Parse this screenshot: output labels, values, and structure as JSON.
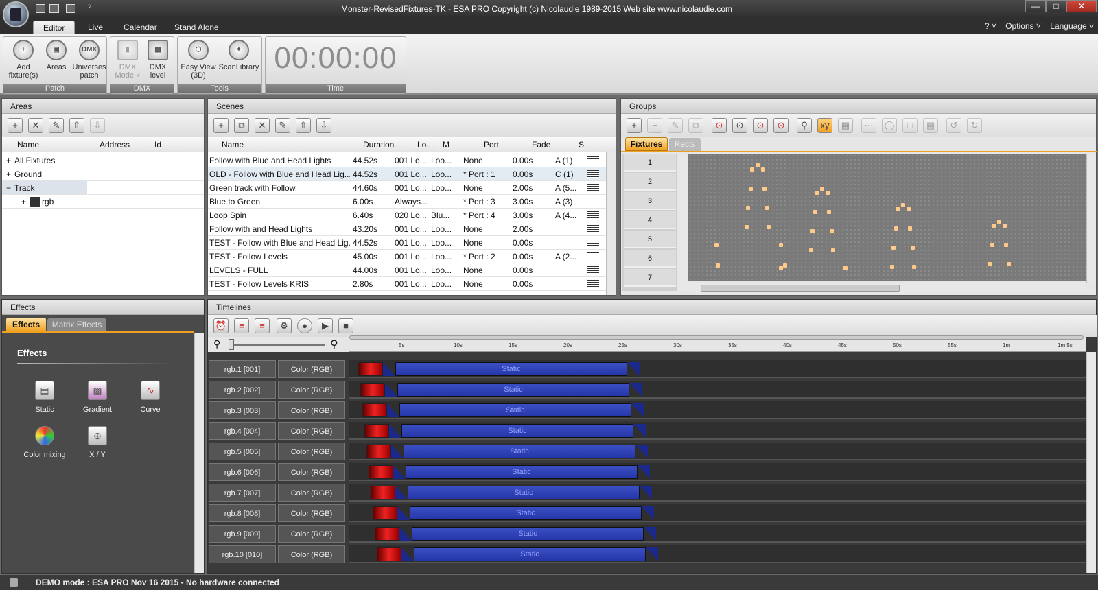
{
  "window": {
    "title": "Monster-RevisedFixtures-TK - ESA PRO    Copyright (c) Nicolaudie 1989-2015    Web site www.nicolaudie.com",
    "minimize": "—",
    "maximize": "□",
    "close": "✕"
  },
  "tabs": [
    "Editor",
    "Live",
    "Calendar",
    "Stand Alone"
  ],
  "right_menu": {
    "help": "? ˅",
    "options": "Options ˅",
    "language": "Language ˅"
  },
  "ribbon": {
    "patch": {
      "label": "Patch",
      "buttons": [
        "Add fixture(s)",
        "Areas",
        "Universes patch"
      ]
    },
    "dmx": {
      "label": "DMX",
      "buttons": [
        "DMX Mode ˅",
        "DMX level"
      ]
    },
    "tools": {
      "label": "Tools",
      "buttons": [
        "Easy View (3D)",
        "ScanLibrary"
      ]
    },
    "time": {
      "label": "Time",
      "value": "00:00:00"
    }
  },
  "areas": {
    "title": "Areas",
    "columns": [
      "Name",
      "Address",
      "Id"
    ],
    "tree": [
      {
        "label": "All Fixtures",
        "expander": "+"
      },
      {
        "label": "Ground",
        "expander": "+"
      },
      {
        "label": "Track",
        "expander": "−"
      },
      {
        "label": "rgb",
        "expander": "+"
      }
    ]
  },
  "scenes": {
    "title": "Scenes",
    "columns": [
      "Name",
      "Duration",
      "Lo...",
      "M",
      "Port",
      "Fade",
      "S"
    ],
    "rows": [
      [
        "Follow with Blue and Head Lights",
        "44.52s",
        "001 Lo...",
        "Loo...",
        "None",
        "0.00s",
        "A (1)"
      ],
      [
        "OLD - Follow with Blue and Head Lig...",
        "44.52s",
        "001 Lo...",
        "Loo...",
        "* Port : 1",
        "0.00s",
        "C (1)"
      ],
      [
        "Green track with Follow",
        "44.60s",
        "001 Lo...",
        "Loo...",
        "None",
        "2.00s",
        "A (5..."
      ],
      [
        "Blue to Green",
        "6.00s",
        "Always...",
        "",
        "* Port : 3",
        "3.00s",
        "A (3)"
      ],
      [
        "Loop Spin",
        "6.40s",
        "020 Lo...",
        "Blu...",
        "* Port : 4",
        "3.00s",
        "A (4..."
      ],
      [
        "Follow with and Head Lights",
        "43.20s",
        "001 Lo...",
        "Loo...",
        "None",
        "2.00s",
        ""
      ],
      [
        "TEST - Follow with Blue and Head Lig...",
        "44.52s",
        "001 Lo...",
        "Loo...",
        "None",
        "0.00s",
        ""
      ],
      [
        "TEST - Follow Levels",
        "45.00s",
        "001 Lo...",
        "Loo...",
        "* Port : 2",
        "0.00s",
        "A (2..."
      ],
      [
        "LEVELS - FULL",
        "44.00s",
        "001 Lo...",
        "Loo...",
        "None",
        "0.00s",
        ""
      ],
      [
        "TEST - Follow Levels KRIS",
        "2.80s",
        "001 Lo...",
        "Loo...",
        "None",
        "0.00s",
        ""
      ]
    ]
  },
  "groups": {
    "title": "Groups",
    "tabs": [
      "Fixtures",
      "Rects"
    ],
    "row_numbers": [
      "1",
      "2",
      "3",
      "4",
      "5",
      "6",
      "7"
    ]
  },
  "effects": {
    "title": "Effects",
    "tabs": [
      "Effects",
      "Matrix Effects"
    ],
    "heading": "Effects",
    "items": [
      "Static",
      "Gradient",
      "Curve",
      "Color mixing",
      "X / Y"
    ]
  },
  "timelines": {
    "title": "Timelines",
    "ticks": [
      "5s",
      "10s",
      "15s",
      "20s",
      "25s",
      "30s",
      "35s",
      "40s",
      "45s",
      "50s",
      "55s",
      "1m",
      "1m 5s"
    ],
    "rows": [
      {
        "name": "rgb.1 [001]",
        "type": "Color (RGB)",
        "clip": "Static"
      },
      {
        "name": "rgb.2 [002]",
        "type": "Color (RGB)",
        "clip": "Static"
      },
      {
        "name": "rgb.3 [003]",
        "type": "Color (RGB)",
        "clip": "Static"
      },
      {
        "name": "rgb.4 [004]",
        "type": "Color (RGB)",
        "clip": "Static"
      },
      {
        "name": "rgb.5 [005]",
        "type": "Color (RGB)",
        "clip": "Static"
      },
      {
        "name": "rgb.6 [006]",
        "type": "Color (RGB)",
        "clip": "Static"
      },
      {
        "name": "rgb.7 [007]",
        "type": "Color (RGB)",
        "clip": "Static"
      },
      {
        "name": "rgb.8 [008]",
        "type": "Color (RGB)",
        "clip": "Static"
      },
      {
        "name": "rgb.9 [009]",
        "type": "Color (RGB)",
        "clip": "Static"
      },
      {
        "name": "rgb.10 [010]",
        "type": "Color (RGB)",
        "clip": "Static"
      }
    ]
  },
  "status": {
    "text": "DEMO mode : ESA PRO Nov 16 2015 - No hardware connected"
  },
  "colors": {
    "accent_tab": "#f0a020",
    "clip_blue": "#2f42b8",
    "clip_red": "#d41c1c",
    "dot": "#ffc98a"
  }
}
